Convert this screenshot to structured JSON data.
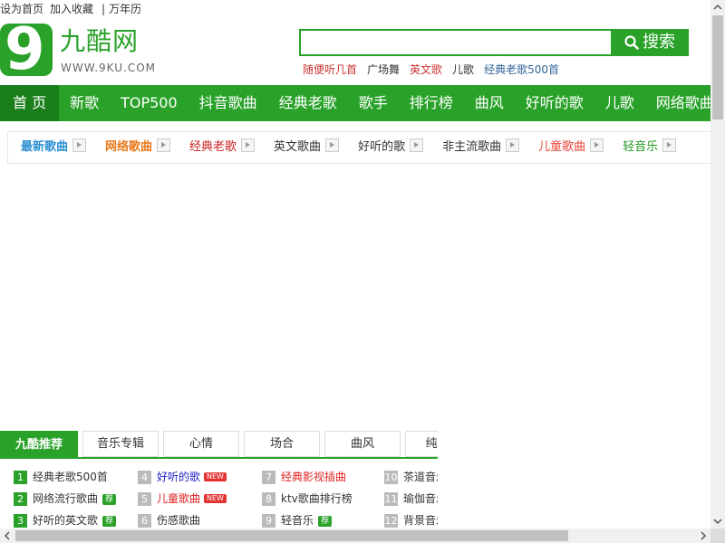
{
  "top_links": [
    "设为首页",
    "加入收藏",
    "万年历"
  ],
  "logo": {
    "digit": "9",
    "name": "九酷网",
    "url": "WWW.9KU.COM"
  },
  "search": {
    "value": "",
    "placeholder": "",
    "button_label": "搜索"
  },
  "hot_words": [
    {
      "label": "随便听几首",
      "color": "#cc3333"
    },
    {
      "label": "广场舞",
      "color": "#333333"
    },
    {
      "label": "英文歌",
      "color": "#cc3333"
    },
    {
      "label": "儿歌",
      "color": "#333333"
    },
    {
      "label": "经典老歌500首",
      "color": "#336699"
    }
  ],
  "main_nav": [
    "首 页",
    "新歌",
    "TOP500",
    "抖音歌曲",
    "经典老歌",
    "歌手",
    "排行榜",
    "曲风",
    "好听的歌",
    "儿歌",
    "网络歌曲"
  ],
  "sub_nav": [
    {
      "label": "最新歌曲",
      "color": "#2a8fd0",
      "bold": true
    },
    {
      "label": "网络歌曲",
      "color": "#e9781c",
      "bold": true
    },
    {
      "label": "经典老歌",
      "color": "#cc2222",
      "bold": false
    },
    {
      "label": "英文歌曲",
      "color": "#333333",
      "bold": false
    },
    {
      "label": "好听的歌",
      "color": "#333333",
      "bold": false
    },
    {
      "label": "非主流歌曲",
      "color": "#333333",
      "bold": false
    },
    {
      "label": "儿童歌曲",
      "color": "#e9463a",
      "bold": false
    },
    {
      "label": "轻音乐",
      "color": "#2a9a2a",
      "bold": false
    }
  ],
  "tabs": [
    "九酷推荐",
    "音乐专辑",
    "心情",
    "场合",
    "曲风",
    "纯音乐"
  ],
  "rank_columns": [
    [
      {
        "num": "1",
        "label": "经典老歌500首",
        "color": "#333333",
        "badge": ""
      },
      {
        "num": "2",
        "label": "网络流行歌曲",
        "color": "#333333",
        "badge": "荐"
      },
      {
        "num": "3",
        "label": "好听的英文歌",
        "color": "#333333",
        "badge": "荐"
      }
    ],
    [
      {
        "num": "4",
        "label": "好听的歌",
        "color": "#2222cc",
        "badge": "NEW"
      },
      {
        "num": "5",
        "label": "儿童歌曲",
        "color": "#e02020",
        "badge": "NEW"
      },
      {
        "num": "6",
        "label": "伤感歌曲",
        "color": "#333333",
        "badge": ""
      }
    ],
    [
      {
        "num": "7",
        "label": "经典影视插曲",
        "color": "#e02020",
        "badge": ""
      },
      {
        "num": "8",
        "label": "ktv歌曲排行榜",
        "color": "#333333",
        "badge": ""
      },
      {
        "num": "9",
        "label": "轻音乐",
        "color": "#333333",
        "badge": "荐"
      }
    ],
    [
      {
        "num": "10",
        "label": "茶道音乐",
        "color": "#333333",
        "badge": ""
      },
      {
        "num": "11",
        "label": "瑜伽音乐",
        "color": "#333333",
        "badge": ""
      },
      {
        "num": "12",
        "label": "背景音乐",
        "color": "#333333",
        "badge": ""
      }
    ]
  ],
  "colors": {
    "brand_green": "#2aa22a",
    "nav_active": "#1a7f1a"
  }
}
